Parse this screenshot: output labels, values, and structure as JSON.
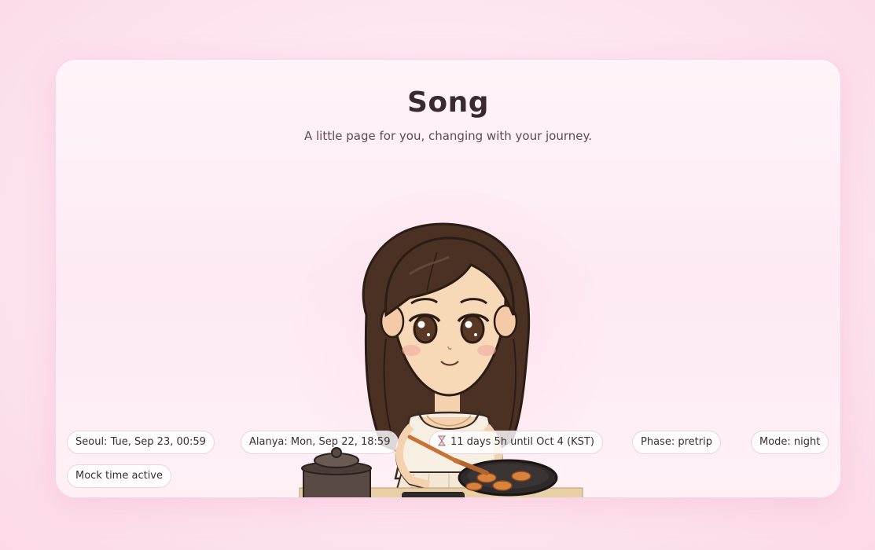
{
  "page": {
    "title": "Song",
    "subtitle": "A little page for you, changing with your journey."
  },
  "illustration": {
    "subject": "chibi girl cooking with a frying pan and wooden spatula",
    "icon": "girl-cooking-illustration"
  },
  "status_chips": {
    "seoul": "Seoul: Tue, Sep 23, 00:59",
    "alanya": "Alanya: Mon, Sep 22, 18:59",
    "countdown": "11 days 5h until Oct 4 (KST)",
    "countdown_icon": "hourglass-icon",
    "phase": "Phase: pretrip",
    "mode": "Mode: night",
    "mock": "Mock time active"
  },
  "colors": {
    "background": "#fde6f0",
    "card": "#fff4f9",
    "chip_border": "#ecd3dc",
    "title_text": "#3a2a30"
  }
}
